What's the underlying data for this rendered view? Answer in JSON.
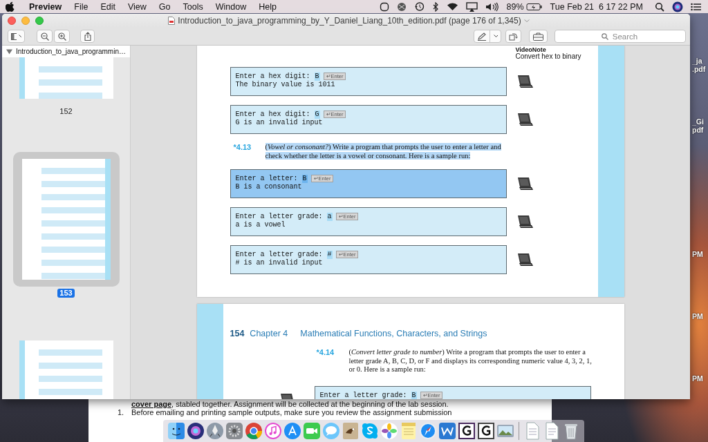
{
  "menu_bar": {
    "app": "Preview",
    "menus": [
      "File",
      "Edit",
      "View",
      "Go",
      "Tools",
      "Window",
      "Help"
    ],
    "battery": "89%",
    "date": "Tue Feb 21",
    "time": "6 17 22 PM"
  },
  "window": {
    "title": "Introduction_to_java_programming_by_Y_Daniel_Liang_10th_edition.pdf (page 176 of 1,345)",
    "search": {
      "placeholder": "Search"
    }
  },
  "sidebar": {
    "title": "Introduction_to_java_programmin…",
    "expanded": true,
    "thumbnails": [
      {
        "label": "152",
        "selected": false
      },
      {
        "label": "153",
        "selected": true
      },
      {
        "selected": false
      }
    ]
  },
  "pages": [
    {
      "margin_note": {
        "title": "VideoNote",
        "text": "Convert hex to binary"
      },
      "items": [
        {
          "kind": "console",
          "prompt": "Enter a hex digit:",
          "input": "B",
          "key": "↵Enter",
          "output": "The binary value is 1011",
          "highlighted": false
        },
        {
          "kind": "console",
          "prompt": "Enter a hex digit:",
          "input": "G",
          "key": "↵Enter",
          "output": "G is an invalid input",
          "highlighted": false
        },
        {
          "kind": "exercise",
          "number": "*4.13",
          "text": "(*Vowel or consonant?*) Write a program that prompts the user to enter a letter and check whether the letter is a vowel or consonant. Here is a sample run:",
          "highlighted": true
        },
        {
          "kind": "console",
          "prompt": "Enter a letter:",
          "input": "B",
          "key": "↵Enter",
          "output": "B is a consonant",
          "highlighted": true
        },
        {
          "kind": "console",
          "prompt": "Enter a letter grade:",
          "input": "a",
          "key": "↵Enter",
          "output": "a is a vowel",
          "highlighted": false
        },
        {
          "kind": "console",
          "prompt": "Enter a letter grade:",
          "input": "#",
          "key": "↵Enter",
          "output": "# is an invalid input",
          "highlighted": false
        }
      ]
    },
    {
      "header": {
        "page_number": "154",
        "chapter": "Chapter 4",
        "title": "Mathematical Functions, Characters, and Strings"
      },
      "items": [
        {
          "kind": "exercise",
          "number": "*4.14",
          "text": "(*Convert letter grade to number*) Write a program that prompts the user to enter a letter grade A, B, C, D, or F and displays its corresponding numeric value 4, 3, 2, 1, or 0. Here is a sample run:",
          "highlighted": false
        },
        {
          "kind": "console",
          "prompt": "Enter a letter grade:",
          "input": "B",
          "key": "↵Enter",
          "highlighted": false
        }
      ]
    }
  ],
  "back_document": {
    "paragraphs": [
      {
        "text": "**cover page**, stabled together.  Assignment will be collected at the beginning of the lab session."
      },
      {
        "number": "1.",
        "text": "Before emailing and printing sample outputs, make sure you review the assignment submission"
      }
    ]
  },
  "desktop_icons": [
    {
      "lines": [
        "_ja",
        ".pdf"
      ]
    },
    {
      "lines": [
        "_Gi",
        "pdf"
      ]
    },
    {
      "lines": [
        "PM"
      ]
    },
    {
      "lines": [
        "PM"
      ]
    },
    {
      "lines": [
        "PM"
      ]
    }
  ]
}
